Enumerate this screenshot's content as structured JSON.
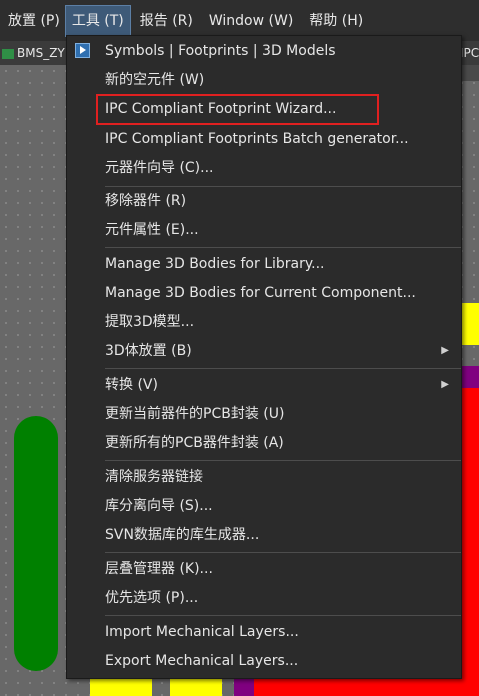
{
  "menubar": {
    "items": [
      {
        "label": "放置 (P)"
      },
      {
        "label": "工具 (T)"
      },
      {
        "label": "报告 (R)"
      },
      {
        "label": "Window (W)"
      },
      {
        "label": "帮助 (H)"
      }
    ]
  },
  "tabs": {
    "left_label": "BMS_ZY",
    "right_label": "IPC"
  },
  "tools_menu": {
    "items": [
      {
        "label": "Symbols | Footprints | 3D Models",
        "icon": "play-icon"
      },
      {
        "label": "新的空元件 (W)"
      },
      {
        "label": "IPC Compliant Footprint Wizard...",
        "highlighted": true
      },
      {
        "label": "IPC Compliant Footprints Batch generator..."
      },
      {
        "label": "元器件向导 (C)..."
      },
      {
        "label": "移除器件 (R)"
      },
      {
        "label": "元件属性 (E)..."
      },
      {
        "label": "Manage 3D Bodies for Library..."
      },
      {
        "label": "Manage 3D Bodies for Current Component..."
      },
      {
        "label": "提取3D模型..."
      },
      {
        "label": "3D体放置 (B)",
        "submenu": true
      },
      {
        "label": "转换 (V)",
        "submenu": true
      },
      {
        "label": "更新当前器件的PCB封装 (U)"
      },
      {
        "label": "更新所有的PCB器件封装 (A)"
      },
      {
        "label": "清除服务器链接"
      },
      {
        "label": "库分离向导 (S)..."
      },
      {
        "label": "SVN数据库的库生成器..."
      },
      {
        "label": "层叠管理器 (K)..."
      },
      {
        "label": "优先选项 (P)..."
      },
      {
        "label": "Import Mechanical Layers..."
      },
      {
        "label": "Export Mechanical Layers..."
      }
    ],
    "submenu_arrow": "▶"
  },
  "colors": {
    "menu_bg": "#2b2b2b",
    "highlight_border": "#e02020",
    "active_menu": "#3e5a78",
    "canvas": "#686868",
    "pad_green": "#008000",
    "pad_yellow": "#ffff00",
    "pad_red": "#ff0000",
    "pad_purple": "#800080"
  }
}
